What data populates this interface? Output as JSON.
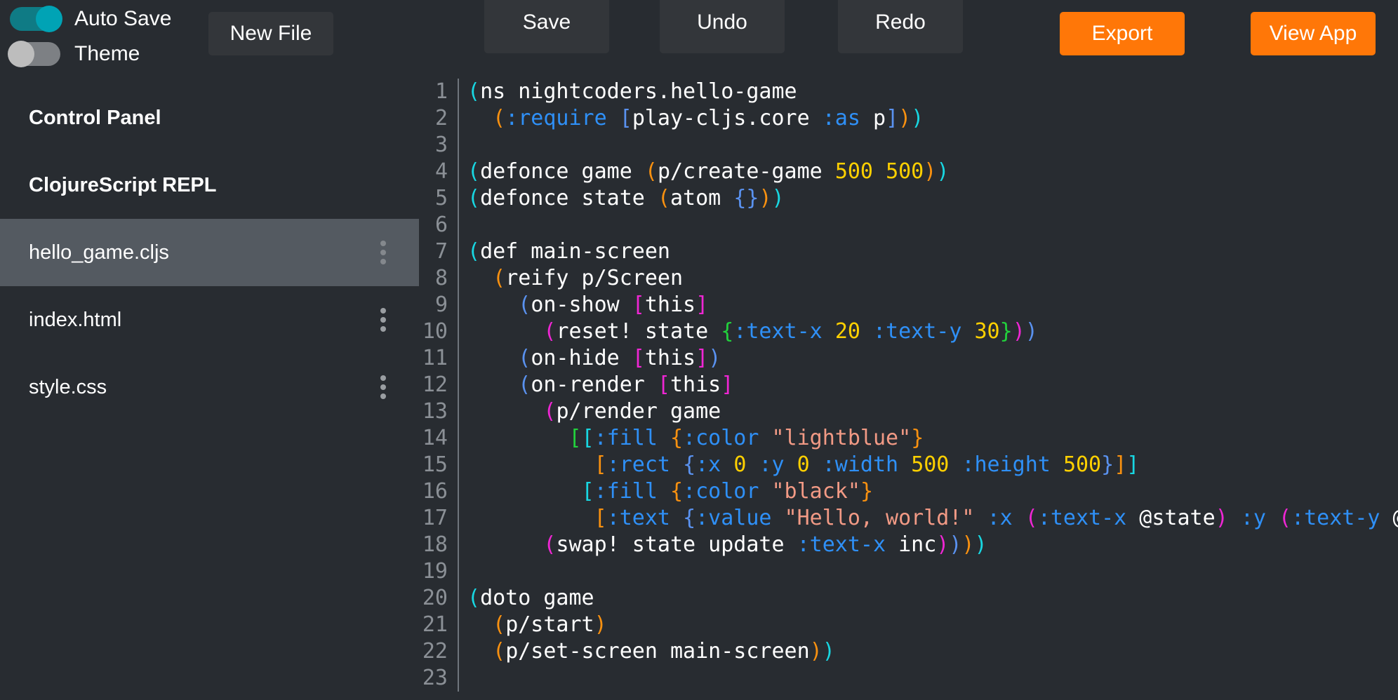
{
  "toolbar": {
    "toggles": [
      {
        "name": "auto-save",
        "label": "Auto Save",
        "state": "on"
      },
      {
        "name": "theme",
        "label": "Theme",
        "state": "off"
      }
    ],
    "buttons": {
      "new_file": "New File",
      "save": "Save",
      "undo": "Undo",
      "redo": "Redo",
      "export": "Export",
      "view_app": "View App"
    },
    "colors": {
      "accent_orange": "#ff7708",
      "toggle_on": "#00a3b5",
      "toggle_off": "#bdbdbd",
      "button_dark": "#33363a"
    }
  },
  "sidebar": {
    "headings": {
      "control_panel": "Control Panel",
      "repl": "ClojureScript REPL"
    },
    "files": [
      {
        "name": "hello_game.cljs",
        "selected": true,
        "menu_icon": "kebab-menu-icon"
      },
      {
        "name": "index.html",
        "selected": false,
        "menu_icon": "kebab-menu-icon"
      },
      {
        "name": "style.css",
        "selected": false,
        "menu_icon": "kebab-menu-icon"
      }
    ],
    "selected_bg": "#545a61"
  },
  "editor": {
    "language": "clojurescript",
    "filename": "hello_game.cljs",
    "first_line": 1,
    "last_line": 23,
    "line_numbers": [
      1,
      2,
      3,
      4,
      5,
      6,
      7,
      8,
      9,
      10,
      11,
      12,
      13,
      14,
      15,
      16,
      17,
      18,
      19,
      20,
      21,
      22,
      23
    ],
    "lines": [
      "(ns nightcoders.hello-game",
      "  (:require [play-cljs.core :as p]))",
      "",
      "(defonce game (p/create-game 500 500))",
      "(defonce state (atom {}))",
      "",
      "(def main-screen",
      "  (reify p/Screen",
      "    (on-show [this]",
      "      (reset! state {:text-x 20 :text-y 30}))",
      "    (on-hide [this])",
      "    (on-render [this]",
      "      (p/render game",
      "        [[:fill {:color \"lightblue\"}",
      "          [:rect {:x 0 :y 0 :width 500 :height 500}]]",
      "         [:fill {:color \"black\"}",
      "          [:text {:value \"Hello, world!\" :x (:text-x @state) :y (:text-y @state)}]]])",
      "      (swap! state update :text-x inc))))",
      "",
      "(doto game",
      "  (p/start)",
      "  (p/set-screen main-screen))",
      ""
    ],
    "syntax_colors": {
      "paren_depth_0": "#18d7e2",
      "paren_depth_1": "#f99110",
      "paren_depth_2": "#5a92f0",
      "paren_depth_3": "#ef26d4",
      "paren_depth_4": "#22d13c",
      "keyword": "#2f90f7",
      "number": "#ffd000",
      "string": "#f29a85",
      "symbol": "#ffffff",
      "line_number": "#8b9096",
      "background": "#282c31"
    }
  }
}
